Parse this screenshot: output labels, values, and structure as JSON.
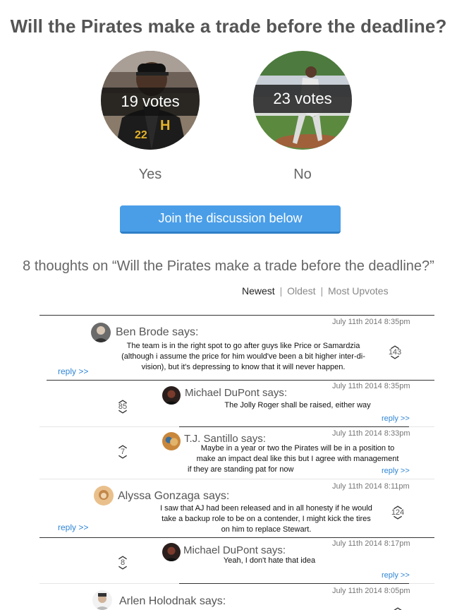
{
  "poll": {
    "question": "Will the Pirates make a trade before the deadline?",
    "options": [
      {
        "label": "Yes",
        "votes": "19 votes"
      },
      {
        "label": "No",
        "votes": "23 votes"
      }
    ],
    "join_label": "Join the discussion below"
  },
  "discussion": {
    "heading": "8 thoughts on “Will the Pirates make a trade before the deadline?”",
    "sort": {
      "newest": "Newest",
      "oldest": "Oldest",
      "upvotes": "Most Upvotes",
      "separator": "|"
    }
  },
  "comments": [
    {
      "author": "Ben Brode says:",
      "date": "July 11th 2014 8:35pm",
      "lines": [
        "The team is in the right spot to go after guys like Price or Samardzia",
        "(although i assume the price for him would've been a bit higher inter-di-",
        "vision), but it's depressing to know that it will never happen."
      ],
      "upvotes": "143",
      "reply": "reply >>"
    },
    {
      "author": "Michael DuPont says:",
      "date": "July 11th 2014 8:35pm",
      "lines": [
        "The Jolly Roger shall be raised, either way"
      ],
      "upvotes": "85",
      "reply": "reply >>"
    },
    {
      "author": "T.J. Santillo says:",
      "date": "July 11th 2014 8:33pm",
      "lines": [
        "Maybe in a year or two the Pirates will be in a position to",
        "make an impact deal like this but I agree with management",
        "if they are standing pat for now"
      ],
      "upvotes": "7",
      "reply": "reply >>"
    },
    {
      "author": "Alyssa Gonzaga says:",
      "date": "July 11th 2014 8:11pm",
      "lines": [
        "I saw that AJ had been released and in all honesty if he would",
        "take a backup role to be on a contender, I might kick the tires",
        "on him to replace Stewart."
      ],
      "upvotes": "124",
      "reply": "reply >>"
    },
    {
      "author": "Michael DuPont says:",
      "date": "July 11th 2014 8:17pm",
      "lines": [
        "Yeah, I don't hate that idea"
      ],
      "upvotes": "8",
      "reply": "reply >>"
    },
    {
      "author": "Arlen Holodnak says:",
      "date": "July 11th 2014 8:05pm"
    }
  ],
  "colors": {
    "accent": "#4a9ee8",
    "link": "#2f86d6",
    "band": "#0f0f0f"
  },
  "icons": {
    "upvote": "chevron-up-down-icon"
  }
}
